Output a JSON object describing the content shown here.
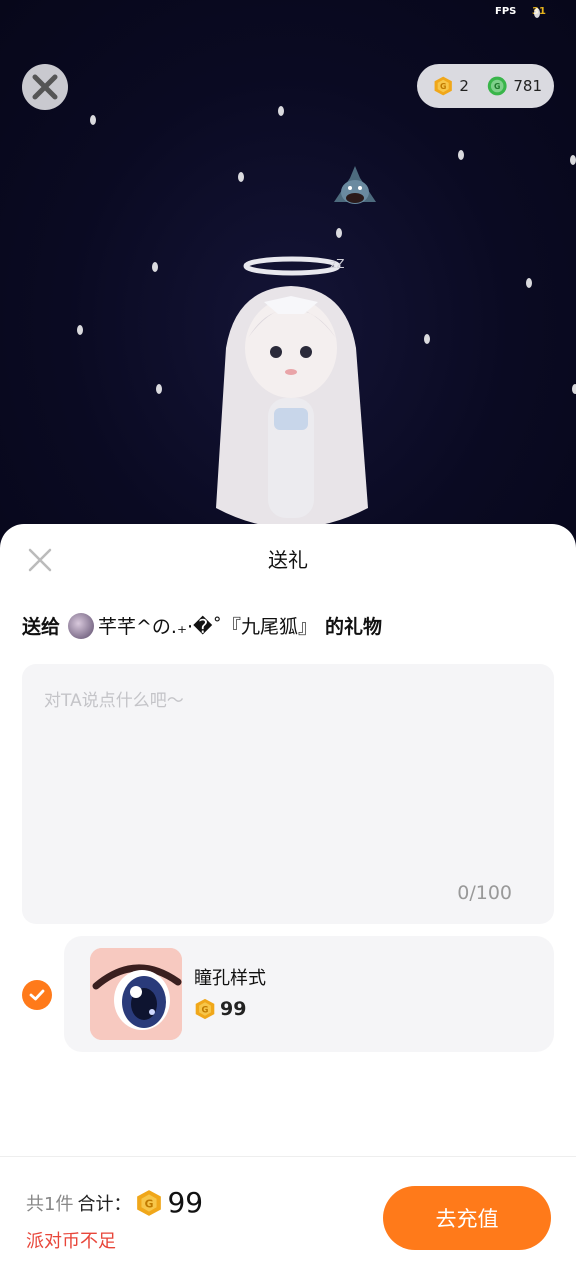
{
  "status": {
    "fps_label": "FPS",
    "fps_value": "31"
  },
  "wallet": {
    "gold_count": "2",
    "green_count": "781"
  },
  "sheet": {
    "title": "送给",
    "title_text": "送礼",
    "gift_to_prefix": "送给",
    "recipient_name": "芊芊^の.₊·�˚『九尾狐』",
    "gift_to_suffix": "的礼物",
    "message_placeholder": "对TA说点什么吧～",
    "message_count": "0/100"
  },
  "gift": {
    "name": "瞳孔样式",
    "price": "99",
    "selected": true
  },
  "footer": {
    "count_text": "共1件",
    "sum_label": "合计：",
    "sum_value": "99",
    "insufficient_text": "派对币不足",
    "recharge_label": "去充值"
  },
  "colors": {
    "accent": "#ff7a1a",
    "coin_gold": "#f0a71a",
    "coin_green": "#39b54a",
    "error": "#e8463a"
  }
}
